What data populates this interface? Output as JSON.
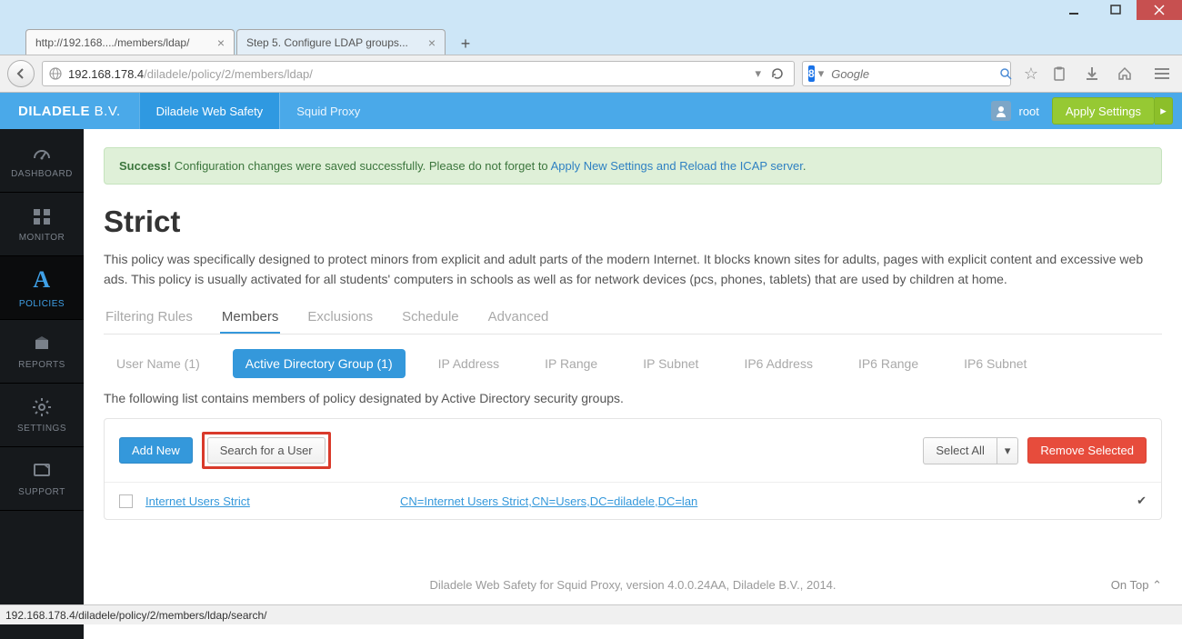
{
  "window": {
    "tabs": [
      {
        "title": "http://192.168..../members/ldap/"
      },
      {
        "title": "Step 5. Configure LDAP groups..."
      }
    ]
  },
  "browser": {
    "url_host": "192.168.178.4",
    "url_path": "/diladele/policy/2/members/ldap/",
    "search_engine_badge": "8",
    "search_placeholder": "Google"
  },
  "topnav": {
    "brand": "DILADELE",
    "brand_suffix": "B.V.",
    "items": [
      "Diladele Web Safety",
      "Squid Proxy"
    ],
    "user": "root",
    "apply": "Apply Settings"
  },
  "sidebar": {
    "items": [
      {
        "label": "DASHBOARD"
      },
      {
        "label": "MONITOR"
      },
      {
        "label": "POLICIES"
      },
      {
        "label": "REPORTS"
      },
      {
        "label": "SETTINGS"
      },
      {
        "label": "SUPPORT"
      }
    ]
  },
  "alert": {
    "prefix": "Success!",
    "text": "Configuration changes were saved successfully. Please do not forget to ",
    "link": "Apply New Settings and Reload the ICAP server",
    "suffix": "."
  },
  "page": {
    "title": "Strict",
    "description": "This policy was specifically designed to protect minors from explicit and adult parts of the modern Internet. It blocks known sites for adults, pages with explicit content and excessive web ads. This policy is usually activated for all students' computers in schools as well as for network devices (pcs, phones, tablets) that are used by children at home."
  },
  "tabs_primary": [
    "Filtering Rules",
    "Members",
    "Exclusions",
    "Schedule",
    "Advanced"
  ],
  "tabs_secondary": [
    "User Name (1)",
    "Active Directory Group (1)",
    "IP Address",
    "IP Range",
    "IP Subnet",
    "IP6 Address",
    "IP6 Range",
    "IP6 Subnet"
  ],
  "sub_description": "The following list contains members of policy designated by Active Directory security groups.",
  "buttons": {
    "add_new": "Add New",
    "search_user": "Search for a User",
    "select_all": "Select All",
    "remove_selected": "Remove Selected"
  },
  "rows": [
    {
      "name": "Internet Users Strict",
      "dn": "CN=Internet Users Strict,CN=Users,DC=diladele,DC=lan"
    }
  ],
  "footer": {
    "text": "Diladele Web Safety for Squid Proxy, version 4.0.0.24AA, Diladele B.V., 2014.",
    "ontop": "On Top"
  },
  "status_bar": "192.168.178.4/diladele/policy/2/members/ldap/search/"
}
